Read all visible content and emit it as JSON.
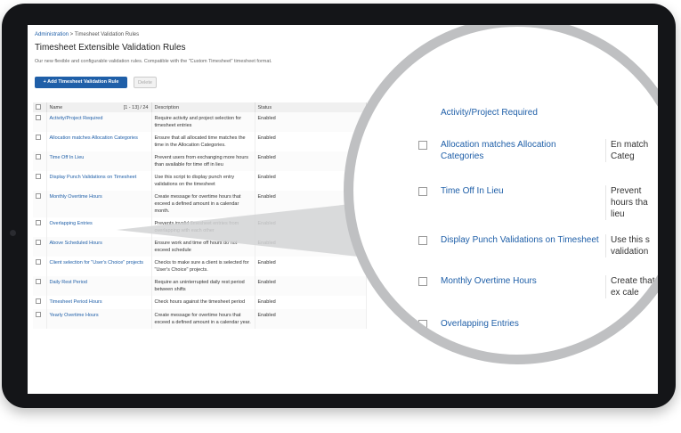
{
  "breadcrumb": {
    "root": "Administration",
    "separator": " > ",
    "current": "Timesheet Validation Rules"
  },
  "page": {
    "title": "Timesheet Extensible Validation Rules",
    "description": "Our new flexible and configurable validation rules. Compatible with the \"Custom Timesheet\" timesheet format."
  },
  "toolbar": {
    "add_label": "+ Add Timesheet Validation Rule",
    "delete_label": "Delete"
  },
  "table": {
    "headers": {
      "name": "Name",
      "range": "[1 - 13] / 24",
      "description": "Description",
      "status": "Status"
    },
    "rows": [
      {
        "name": "Activity/Project Required",
        "description": "Require activity and project selection for timesheet entries",
        "status": "Enabled"
      },
      {
        "name": "Allocation matches Allocation Categories",
        "description": "Ensure that all allocated time matches the time in the Allocation Categories.",
        "status": "Enabled"
      },
      {
        "name": "Time Off In Lieu",
        "description": "Prevent users from exchanging more hours than available for time off in lieu",
        "status": "Enabled"
      },
      {
        "name": "Display Punch Validations on Timesheet",
        "description": "Use this script to display punch entry validations on the timesheet",
        "status": "Enabled"
      },
      {
        "name": "Monthly Overtime Hours",
        "description": "Create message for overtime hours that exceed a defined amount in a calendar month.",
        "status": "Enabled"
      },
      {
        "name": "Overlapping Entries",
        "description": "Prevents invalid timesheet entries from overlapping with each other",
        "status": "Enabled"
      },
      {
        "name": "Above Scheduled Hours",
        "description": "Ensure work and time off hours do not exceed schedule",
        "status": "Enabled"
      },
      {
        "name": "Client selection for \"User's Choice\" projects",
        "description": "Checks to make sure a client is selected for \"User's Choice\" projects.",
        "status": "Enabled"
      },
      {
        "name": "Daily Rest Period",
        "description": "Require an uninterrupted daily rest period between shifts",
        "status": "Enabled"
      },
      {
        "name": "Timesheet Period Hours",
        "description": "Check hours against the timesheet period",
        "status": "Enabled"
      },
      {
        "name": "Yearly Overtime Hours",
        "description": "Create message for overtime hours that exceed a defined amount in a calendar year.",
        "status": "Enabled"
      }
    ]
  },
  "magnifier": {
    "rows": [
      {
        "name": "Activity/Project Required",
        "description": ""
      },
      {
        "name": "Allocation matches Allocation Categories",
        "description": "En match Categ"
      },
      {
        "name": "Time Off In Lieu",
        "description": "Prevent hours tha lieu"
      },
      {
        "name": "Display Punch Validations on Timesheet",
        "description": "Use this s validation"
      },
      {
        "name": "Monthly Overtime Hours",
        "description": "Create that ex cale"
      },
      {
        "name": "Overlapping Entries",
        "description": ""
      },
      {
        "name": "Above Scheduled Hours",
        "description": ""
      }
    ]
  }
}
